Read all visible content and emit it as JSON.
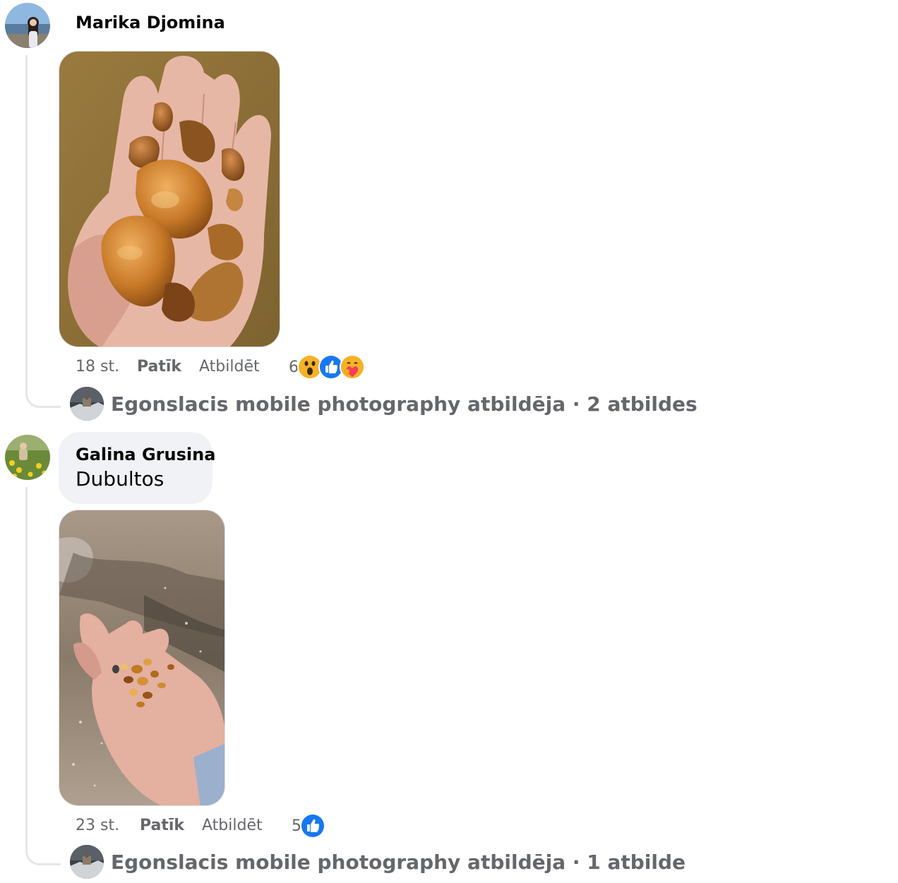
{
  "comments": [
    {
      "author": "Marika Djomina",
      "text": "",
      "time": "18 st.",
      "like_label": "Patīk",
      "reply_label": "Atbildēt",
      "reaction_count": "6",
      "reactions": [
        "wow-reaction-icon",
        "like-reaction-icon",
        "care-reaction-icon"
      ],
      "replies_text": "Egonslacis mobile photography atbildēja · 2 atbildes"
    },
    {
      "author": "Galina Grusina",
      "text": "Dubultos",
      "time": "23 st.",
      "like_label": "Patīk",
      "reply_label": "Atbildēt",
      "reaction_count": "5",
      "reactions": [
        "like-reaction-icon"
      ],
      "replies_text": "Egonslacis mobile photography atbildēja · 1 atbilde"
    }
  ],
  "colors": {
    "secondary_text": "#65676b",
    "bubble_bg": "#f0f2f5",
    "thread_line": "#e4e6eb",
    "like_blue": "#1877f2"
  }
}
